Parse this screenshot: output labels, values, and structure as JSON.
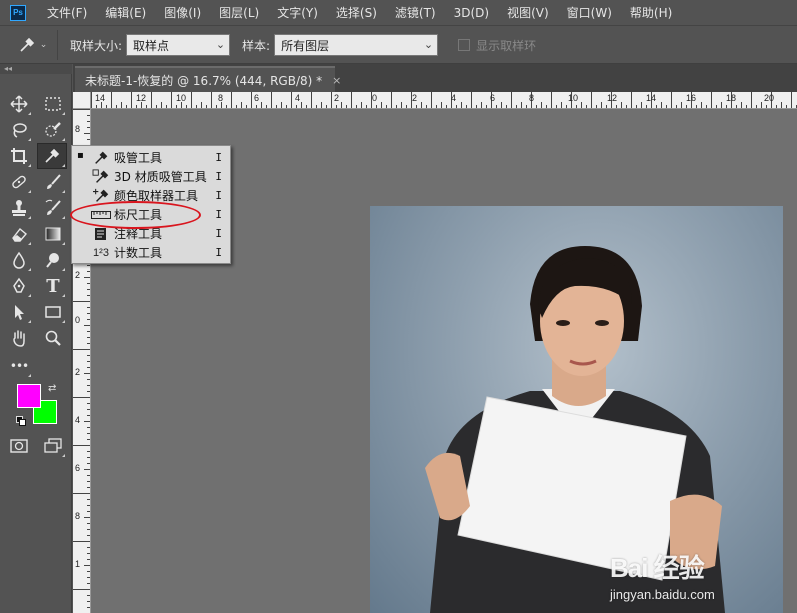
{
  "app": {
    "logo_text": "Ps"
  },
  "menu": [
    "文件(F)",
    "编辑(E)",
    "图像(I)",
    "图层(L)",
    "文字(Y)",
    "选择(S)",
    "滤镜(T)",
    "3D(D)",
    "视图(V)",
    "窗口(W)",
    "帮助(H)"
  ],
  "options_bar": {
    "tool_icon": "eyedropper-icon",
    "sample_size_label": "取样大小:",
    "sample_size_value": "取样点",
    "sample_label": "样本:",
    "sample_value": "所有图层",
    "show_ring_label": "显示取样环"
  },
  "document_tab": {
    "title": "未标题-1-恢复的 @ 16.7% (444, RGB/8) *",
    "close_glyph": "×"
  },
  "rulers": {
    "top": [
      "14",
      "12",
      "10",
      "8",
      "6",
      "4",
      "2",
      "0",
      "2",
      "4",
      "6",
      "8",
      "10",
      "12",
      "14",
      "16",
      "18",
      "20"
    ],
    "left": [
      "8",
      "6",
      "4",
      "2",
      "0",
      "2",
      "4",
      "6",
      "8",
      "1"
    ]
  },
  "toolbar": {
    "collapse_glyph": "◂◂",
    "more_glyph": "•••"
  },
  "colors": {
    "foreground": "#ff00ff",
    "background": "#00ff00",
    "annotation_ring": "#d9151e"
  },
  "flyout": {
    "items": [
      {
        "icon": "eyedropper-icon",
        "label": "吸管工具",
        "shortcut": "I",
        "selected": true
      },
      {
        "icon": "3d-material-eyedropper-icon",
        "label": "3D 材质吸管工具",
        "shortcut": "I",
        "selected": false
      },
      {
        "icon": "color-sampler-icon",
        "label": "颜色取样器工具",
        "shortcut": "I",
        "selected": false
      },
      {
        "icon": "ruler-icon",
        "label": "标尺工具",
        "shortcut": "I",
        "selected": false
      },
      {
        "icon": "note-icon",
        "label": "注释工具",
        "shortcut": "I",
        "selected": false
      },
      {
        "icon": "count-icon",
        "label": "计数工具",
        "shortcut": "I",
        "selected": false
      }
    ],
    "bullet": "▪",
    "count_icon_text": "1²3"
  },
  "watermark": {
    "logo": "Bai 经验",
    "url": "jingyan.baidu.com"
  }
}
